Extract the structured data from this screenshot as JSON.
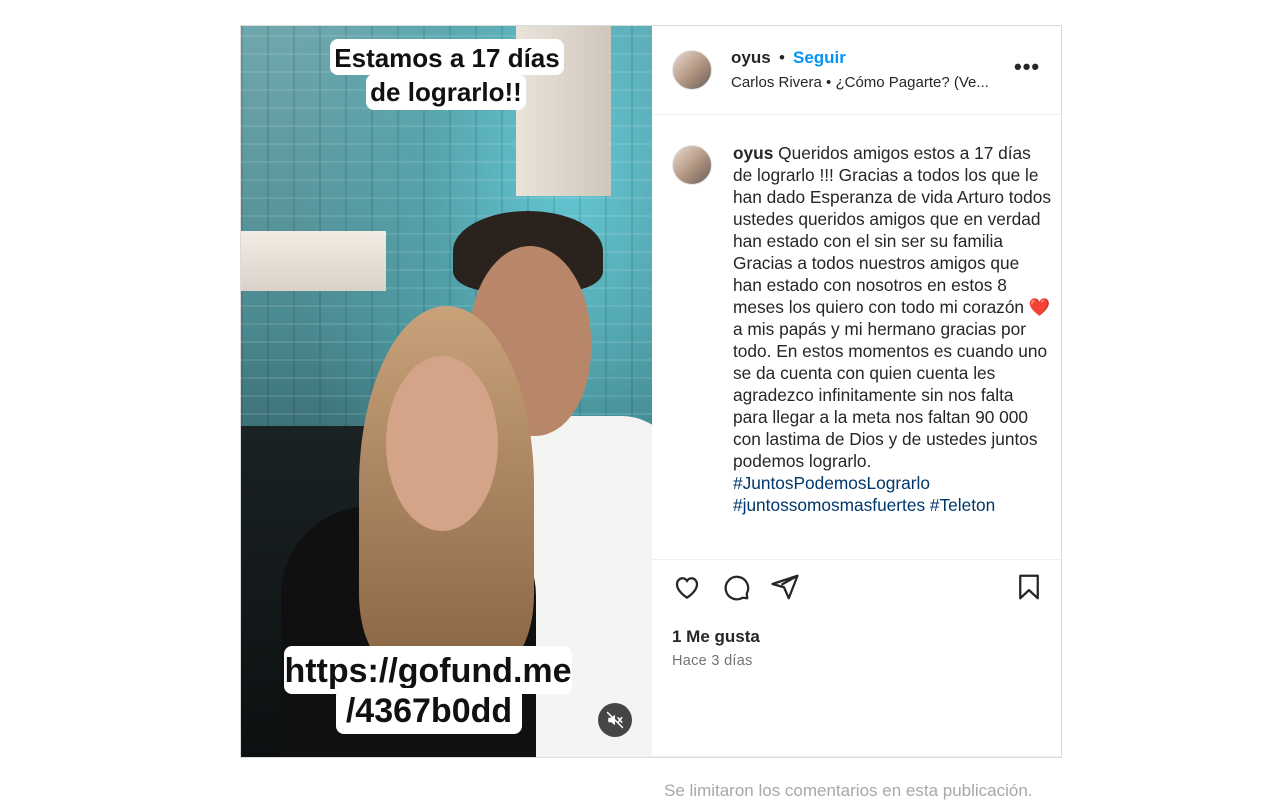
{
  "media": {
    "caption_top_line1": "Estamos a 17 días",
    "caption_top_line2": "de lograrlo!!",
    "caption_bottom_line1": "https://gofund.me",
    "caption_bottom_line2": "/4367b0dd",
    "mute_icon": "speaker-muted-icon"
  },
  "header": {
    "username": "oyus",
    "separator": "•",
    "follow_label": "Seguir",
    "audio": "Carlos Rivera • ¿Cómo Pagarte? (Ve...",
    "more_icon": "•••"
  },
  "caption": {
    "username": "oyus",
    "text": "Queridos amigos estos a 17 días de lograrlo !!! Gracias a todos los que le han dado Esperanza de vida Arturo todos ustedes queridos amigos que en verdad han estado con el sin ser su familia Gracias a todos nuestros amigos que han estado con nosotros en estos 8 meses los quiero con todo mi corazón",
    "emoji": "❤️",
    "text_after": "a mis papás y mi hermano gracias por todo. En estos momentos es cuando uno se da cuenta con quien cuenta les agradezco infinitamente sin nos falta para llegar a la meta nos faltan 90 000 con lastima de Dios y de ustedes juntos podemos lograrlo.",
    "tag1": "#JuntosPodemosLograrlo",
    "tag2": "#juntossomosmasfuertes",
    "tag3": "#Teleton"
  },
  "actions": {
    "like_icon": "heart-icon",
    "comment_icon": "comment-icon",
    "share_icon": "paper-plane-icon",
    "save_icon": "bookmark-icon"
  },
  "meta": {
    "likes": "1 Me gusta",
    "time": "Hace 3 días"
  },
  "comments_notice": "Se limitaron los comentarios en esta publicación.",
  "colors": {
    "follow": "#0095f6",
    "hashtag": "#00376b",
    "muted_text": "#737373"
  }
}
